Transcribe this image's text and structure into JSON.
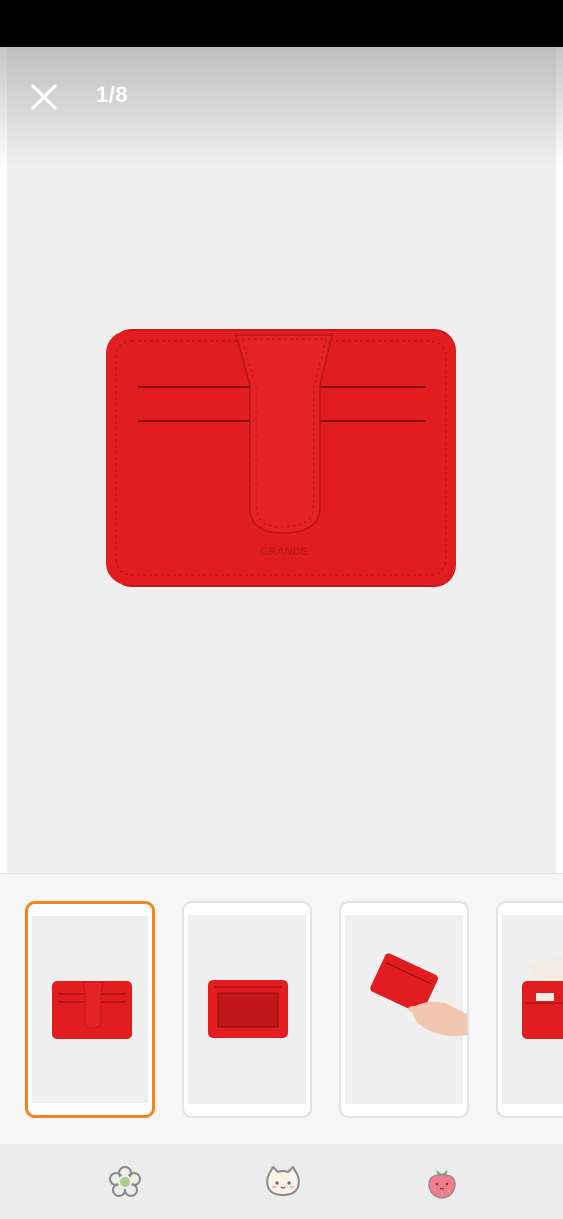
{
  "viewer": {
    "counter": "1/8",
    "close_icon": "close-icon",
    "brand_imprint": "GRANDE"
  },
  "product": {
    "color": "#e21d1f",
    "name_visible": false
  },
  "thumbnails": [
    {
      "id": "thumb-1",
      "selected": true,
      "depicts": "wallet-front"
    },
    {
      "id": "thumb-2",
      "selected": false,
      "depicts": "wallet-back-window"
    },
    {
      "id": "thumb-3",
      "selected": false,
      "depicts": "wallet-in-hand"
    },
    {
      "id": "thumb-4",
      "selected": false,
      "depicts": "wallet-with-cards"
    }
  ],
  "bottom_nav": {
    "items": [
      {
        "icon": "flower-icon"
      },
      {
        "icon": "cat-face-icon"
      },
      {
        "icon": "strawberry-icon"
      }
    ]
  },
  "colors": {
    "accent": "#f0861f",
    "product_red": "#e21d1f",
    "background": "#efefef"
  }
}
